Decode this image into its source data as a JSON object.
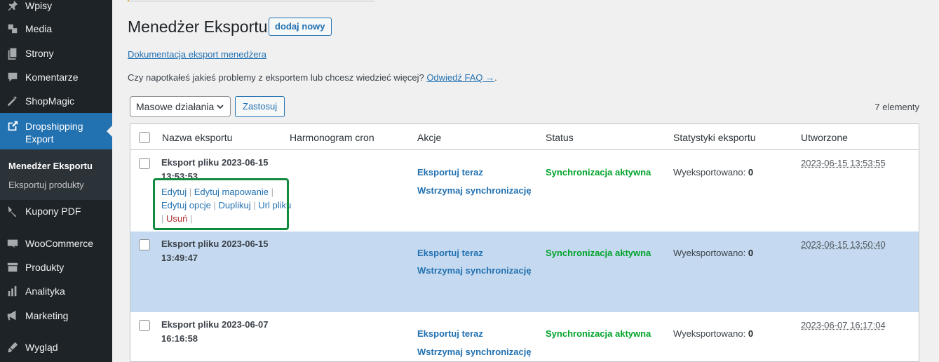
{
  "sidebar": {
    "items": [
      {
        "label": "Wpisy",
        "icon": "pin-icon"
      },
      {
        "label": "Media",
        "icon": "media-icon"
      },
      {
        "label": "Strony",
        "icon": "pages-icon"
      },
      {
        "label": "Komentarze",
        "icon": "comment-icon"
      },
      {
        "label": "ShopMagic",
        "icon": "wand-icon"
      },
      {
        "label": "Dropshipping Export",
        "icon": "external-icon"
      },
      {
        "label": "Kupony PDF",
        "icon": "arrow-icon"
      },
      {
        "label": "WooCommerce",
        "icon": "woo-icon"
      },
      {
        "label": "Produkty",
        "icon": "archive-icon"
      },
      {
        "label": "Analityka",
        "icon": "chart-icon"
      },
      {
        "label": "Marketing",
        "icon": "megaphone-icon"
      },
      {
        "label": "Wygląd",
        "icon": "brush-icon"
      }
    ],
    "submenu": [
      "Menedżer Eksportu",
      "Eksportuj produkty"
    ]
  },
  "header": {
    "title": "Menedżer Eksportu",
    "add_new": "dodaj nowy",
    "doc_link": "Dokumentacja eksport menedżera",
    "faq_text": "Czy napotkałeś jakieś problemy z eksportem lub chcesz wiedzieć więcej?",
    "faq_link": "Odwiedź FAQ →",
    "faq_end": "."
  },
  "toolbar": {
    "bulk_label": "Masowe działania",
    "apply_label": "Zastosuj",
    "count": "7 elementy"
  },
  "table": {
    "columns": [
      "Nazwa eksportu",
      "Harmonogram cron",
      "Akcje",
      "Status",
      "Statystyki eksportu",
      "Utworzone"
    ],
    "row_actions": {
      "edit": "Edytuj",
      "edit_mapping": "Edytuj mapowanie",
      "edit_options": "Edytuj opcje",
      "duplicate": "Duplikuj",
      "url_file": "Url pliku",
      "delete": "Usuń"
    },
    "rows": [
      {
        "name": "Eksport pliku 2023-06-15 13:53:53",
        "export_now": "Eksportuj teraz",
        "pause": "Wstrzymaj synchronizację",
        "status": "Synchronizacja aktywna",
        "stats_label": "Wyeksportowano:",
        "stats_value": "0",
        "created": "2023-06-15 13:53:55"
      },
      {
        "name": "Eksport pliku 2023-06-15 13:49:47",
        "export_now": "Eksportuj teraz",
        "pause": "Wstrzymaj synchronizację",
        "status": "Synchronizacja aktywna",
        "stats_label": "Wyeksportowano:",
        "stats_value": "0",
        "created": "2023-06-15 13:50:40"
      },
      {
        "name": "Eksport pliku 2023-06-07 16:16:58",
        "export_now": "Eksportuj teraz",
        "pause": "Wstrzymaj synchronizację",
        "status": "Synchronizacja aktywna",
        "stats_label": "Wyeksportowano:",
        "stats_value": "0",
        "created": "2023-06-07 16:17:04"
      }
    ]
  },
  "colors": {
    "sidebar_bg": "#1d2327",
    "accent": "#2271b1",
    "status_green": "#00a32a",
    "highlight_green": "#138b3f",
    "selected_row": "#c5daf0"
  }
}
